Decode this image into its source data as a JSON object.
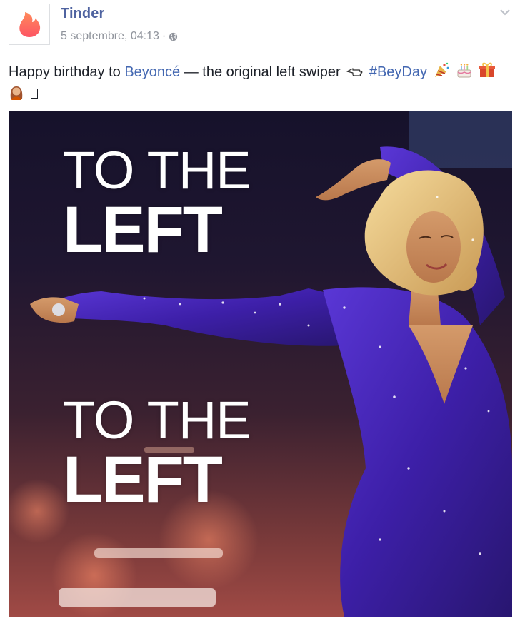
{
  "post": {
    "page_name": "Tinder",
    "timestamp": "5 septembre, 04:13",
    "separator": "·",
    "audience_icon": "globe-icon",
    "options_icon": "chevron-down-icon",
    "avatar_icon": "tinder-flame-icon",
    "message": {
      "intro": "Happy birthday to ",
      "mention": "Beyoncé",
      "middle": " — the original left swiper",
      "hashtag": "#BeyDay",
      "emojis": [
        "backhand-index-pointing-left",
        "party-popper",
        "birthday-cake",
        "wrapped-gift",
        "woman-emoji",
        "missing-glyph"
      ]
    },
    "photo": {
      "line1": "TO THE",
      "line2": "LEFT",
      "line3": "TO THE",
      "line4": "LEFT"
    }
  },
  "colors": {
    "name_blue": "#4f63a0",
    "link_blue": "#4367b1",
    "meta_gray": "#90949c",
    "text": "#1d2129",
    "tinder_flame": "#fd5564",
    "dress_purple": "#3d1fa8"
  }
}
